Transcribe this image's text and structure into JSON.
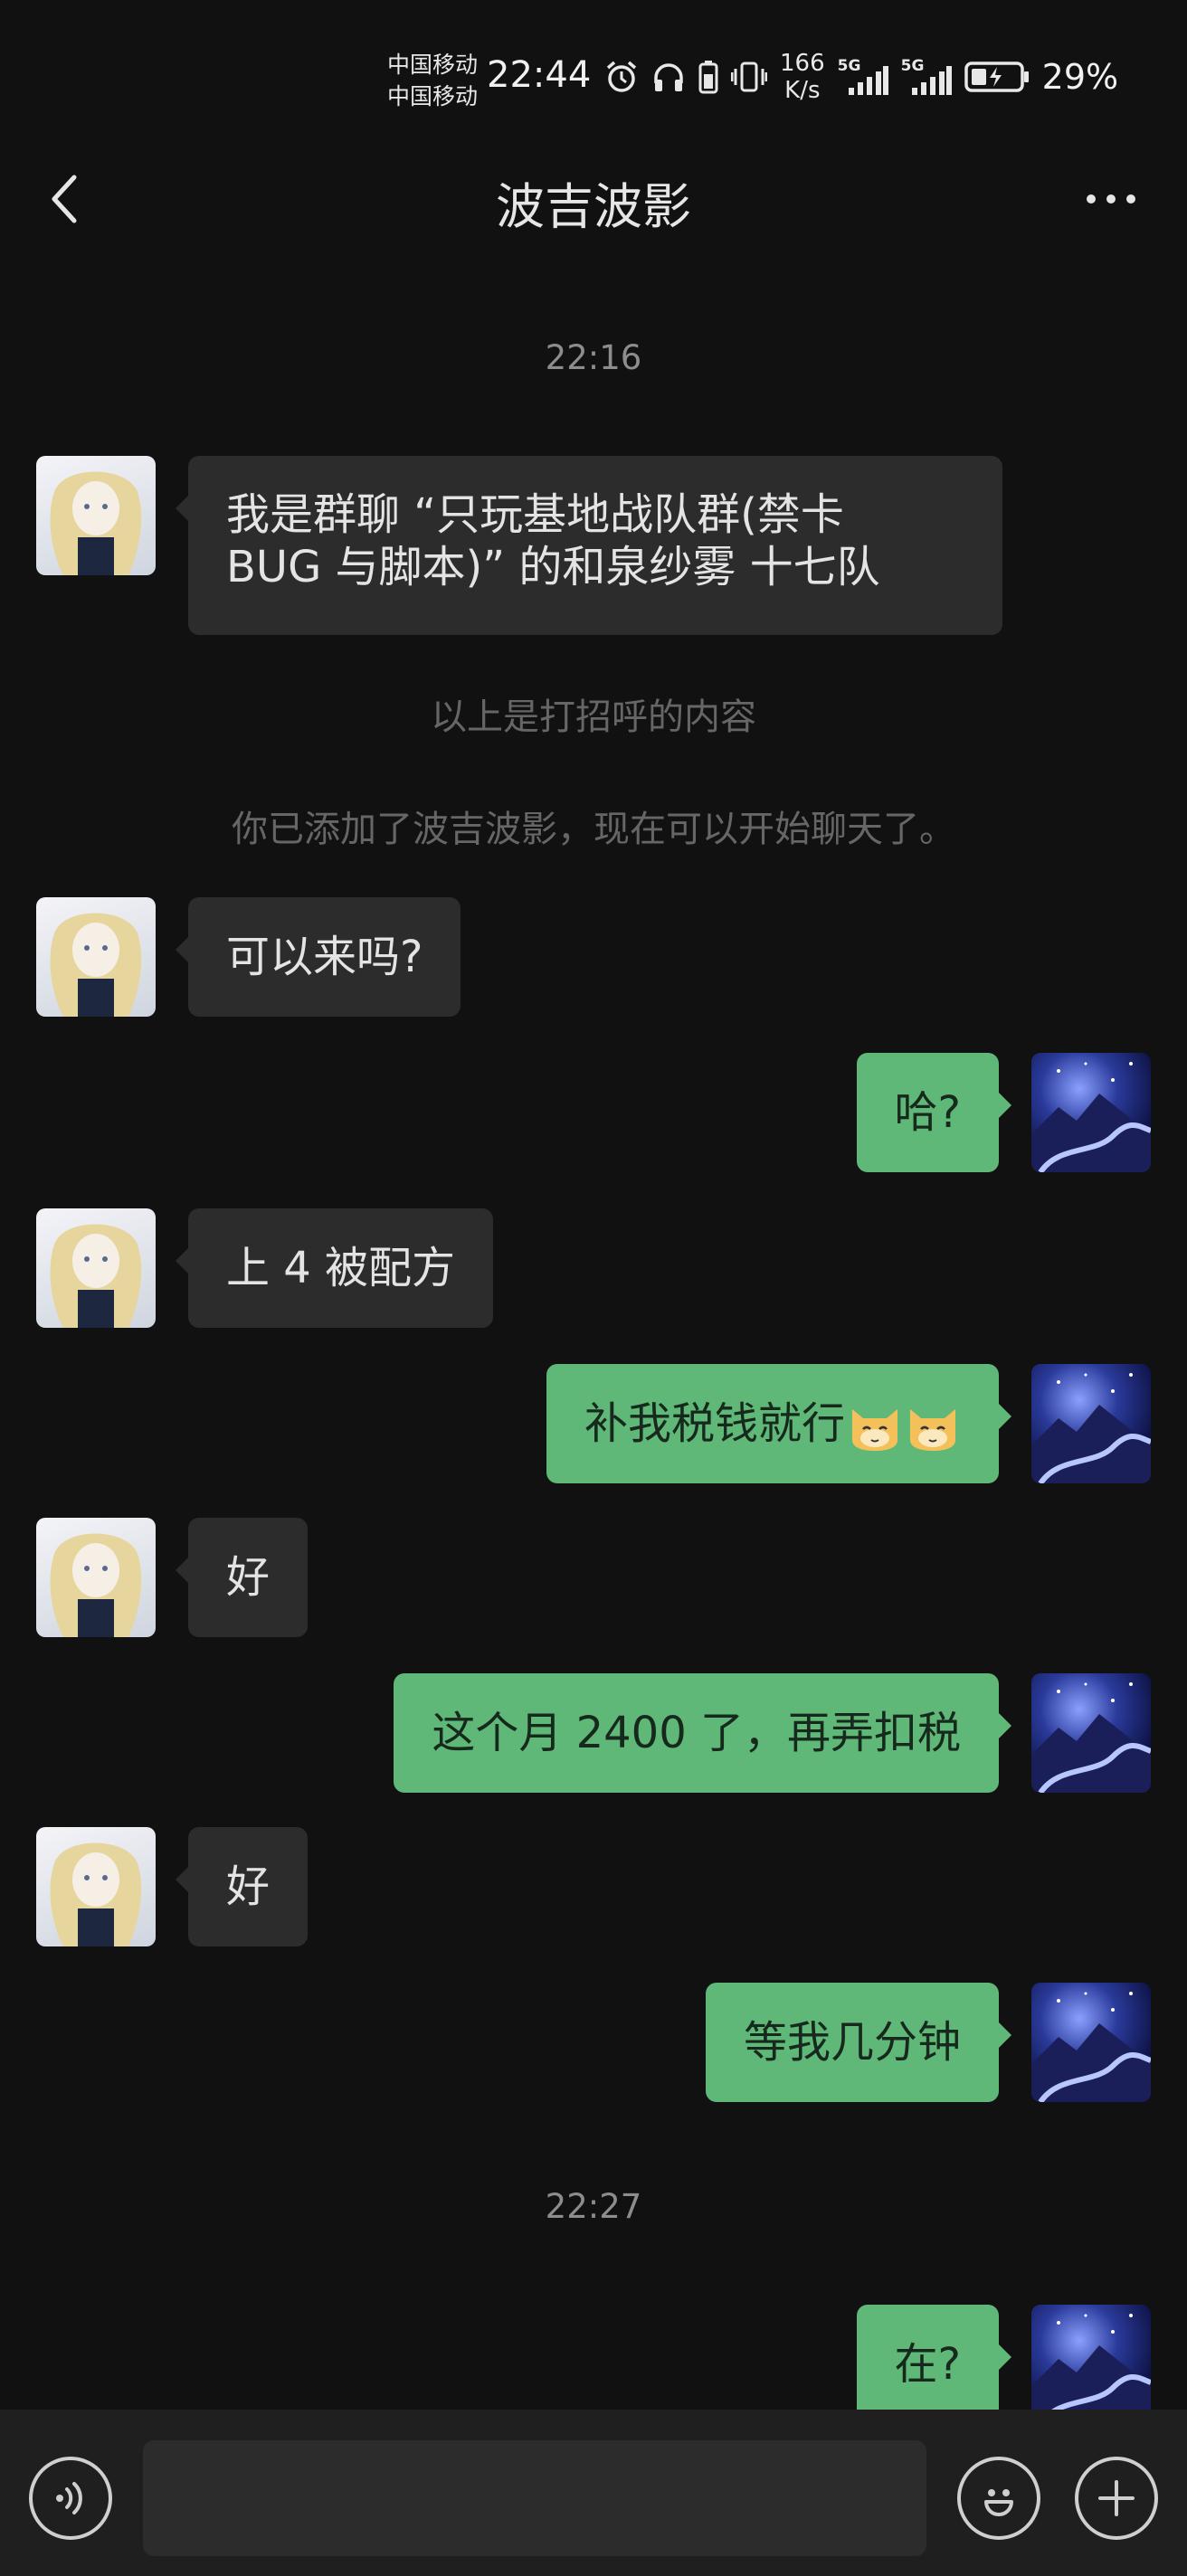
{
  "status_bar": {
    "carrier_1": "中国移动",
    "carrier_2": "中国移动",
    "time": "22:44",
    "net_speed_value": "166",
    "net_speed_unit": "K/s",
    "net_type_1": "5G",
    "net_type_2": "5G",
    "battery_percent": "29%",
    "icons": [
      "alarm-icon",
      "headphones-icon",
      "battery-saver-icon",
      "vibrate-icon",
      "signal-icon",
      "signal-icon",
      "battery-charging-icon"
    ]
  },
  "header": {
    "title": "波吉波影",
    "back_icon": "chevron-left-icon",
    "more_icon": "more-dots-icon"
  },
  "chat": {
    "timestamp_1": "22:16",
    "greeting_message": "我是群聊 “只玩基地战队群(禁卡BUG 与脚本)” 的和泉纱雾 十七队",
    "greeting_line_1": "我是群聊 “只玩基地战队群(禁卡",
    "greeting_line_2": "BUG 与脚本)” 的和泉纱雾 十七队",
    "system_notice_1": "以上是打招呼的内容",
    "system_notice_2": "你已添加了波吉波影，现在可以开始聊天了。",
    "messages": [
      {
        "from": "them",
        "text": "可以来吗?"
      },
      {
        "from": "me",
        "text": "哈?"
      },
      {
        "from": "them",
        "text": "上 4 被配方"
      },
      {
        "from": "me",
        "text": "补我税钱就行",
        "emoji": "cat-smile-emoji"
      },
      {
        "from": "them",
        "text": "好"
      },
      {
        "from": "me",
        "text": "这个月 2400 了，再弄扣税"
      },
      {
        "from": "them",
        "text": "好"
      },
      {
        "from": "me",
        "text": "等我几分钟"
      }
    ],
    "timestamp_2": "22:27",
    "last_message": {
      "from": "me",
      "text": "在?"
    }
  },
  "input_bar": {
    "voice_icon": "voice-icon",
    "emoji_icon": "emoji-icon",
    "plus_icon": "plus-icon",
    "text": ""
  },
  "colors": {
    "background": "#111111",
    "incoming_bubble": "#2c2c2c",
    "outgoing_bubble": "#5fb877",
    "input_bar": "#1f1f1f"
  }
}
